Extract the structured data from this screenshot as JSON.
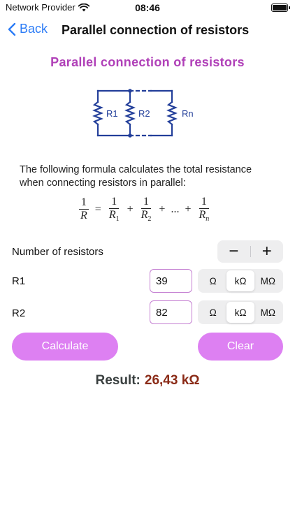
{
  "status_bar": {
    "carrier": "Network Provider",
    "time": "08:46"
  },
  "nav": {
    "back_label": "Back",
    "title": "Parallel connection of resistors"
  },
  "content": {
    "heading": "Parallel connection of resistors",
    "circuit_labels": [
      "R1",
      "R2",
      "Rn"
    ],
    "formula_description": "The following formula calculates the total resistance when connecting resistors in parallel:",
    "formula": {
      "one": "1",
      "lhs_den": "R",
      "r1_base": "R",
      "r1_sub": "1",
      "r2_base": "R",
      "r2_sub": "2",
      "rn_base": "R",
      "rn_sub": "n",
      "equals": "=",
      "plus": "+",
      "ellipsis": "..."
    }
  },
  "controls": {
    "num_resistors_label": "Number of resistors",
    "minus": "−",
    "plus": "+",
    "resistors": [
      {
        "label": "R1",
        "value": "39",
        "units": [
          "Ω",
          "kΩ",
          "MΩ"
        ],
        "selected_unit": "kΩ"
      },
      {
        "label": "R2",
        "value": "82",
        "units": [
          "Ω",
          "kΩ",
          "MΩ"
        ],
        "selected_unit": "kΩ"
      }
    ]
  },
  "actions": {
    "calculate": "Calculate",
    "clear": "Clear"
  },
  "result": {
    "label": "Result:",
    "value": "26,43 kΩ"
  },
  "colors": {
    "accent_blue": "#2c7cf6",
    "heading_purple": "#b040b8",
    "button_purple": "#dd80f2",
    "circuit_blue": "#233f9a",
    "result_value": "#8a2a16"
  }
}
